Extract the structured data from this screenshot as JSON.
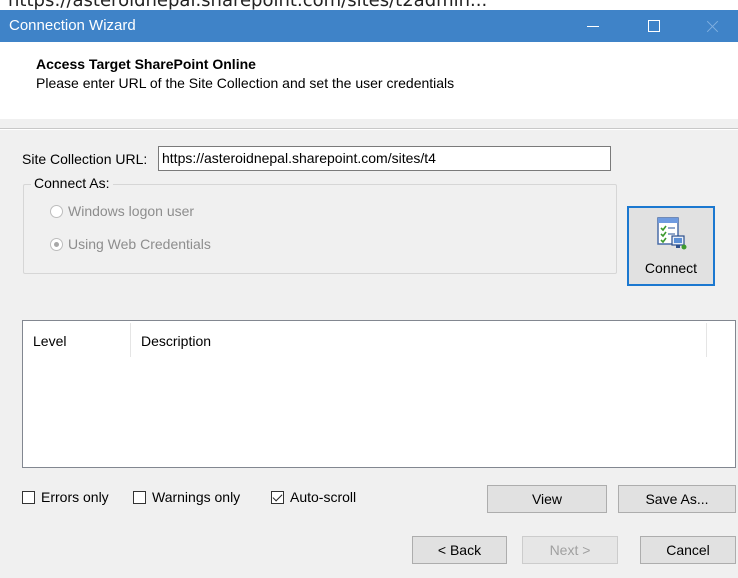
{
  "top_strip_text": "https://asteroidnepal.sharepoint.com/sites/t2admin...",
  "window": {
    "title": "Connection Wizard"
  },
  "header": {
    "title": "Access Target SharePoint Online",
    "subtitle": "Please enter URL of the Site Collection and set the user credentials"
  },
  "form": {
    "url_label": "Site Collection URL:",
    "url_value": "https://asteroidnepal.sharepoint.com/sites/t4",
    "group_title": "Connect As:",
    "options": [
      {
        "label": "Windows logon user",
        "selected": false,
        "enabled": false
      },
      {
        "label": "Using Web Credentials",
        "selected": true,
        "enabled": false
      }
    ],
    "connect_label": "Connect",
    "connect_icon": "connection-settings-icon"
  },
  "log": {
    "columns": [
      "Level",
      "Description"
    ],
    "rows": []
  },
  "filters": {
    "errors_only": {
      "label": "Errors only",
      "checked": false
    },
    "warnings_only": {
      "label": "Warnings only",
      "checked": false
    },
    "auto_scroll": {
      "label": "Auto-scroll",
      "checked": true
    }
  },
  "actions": {
    "view": "View",
    "save_as": "Save As...",
    "back": "< Back",
    "next": "Next >",
    "cancel": "Cancel"
  },
  "colors": {
    "titlebar": "#3f83c8",
    "focus_border": "#1b78d0",
    "button_face": "#e1e1e1",
    "dialog_bg": "#f0f0f0"
  }
}
